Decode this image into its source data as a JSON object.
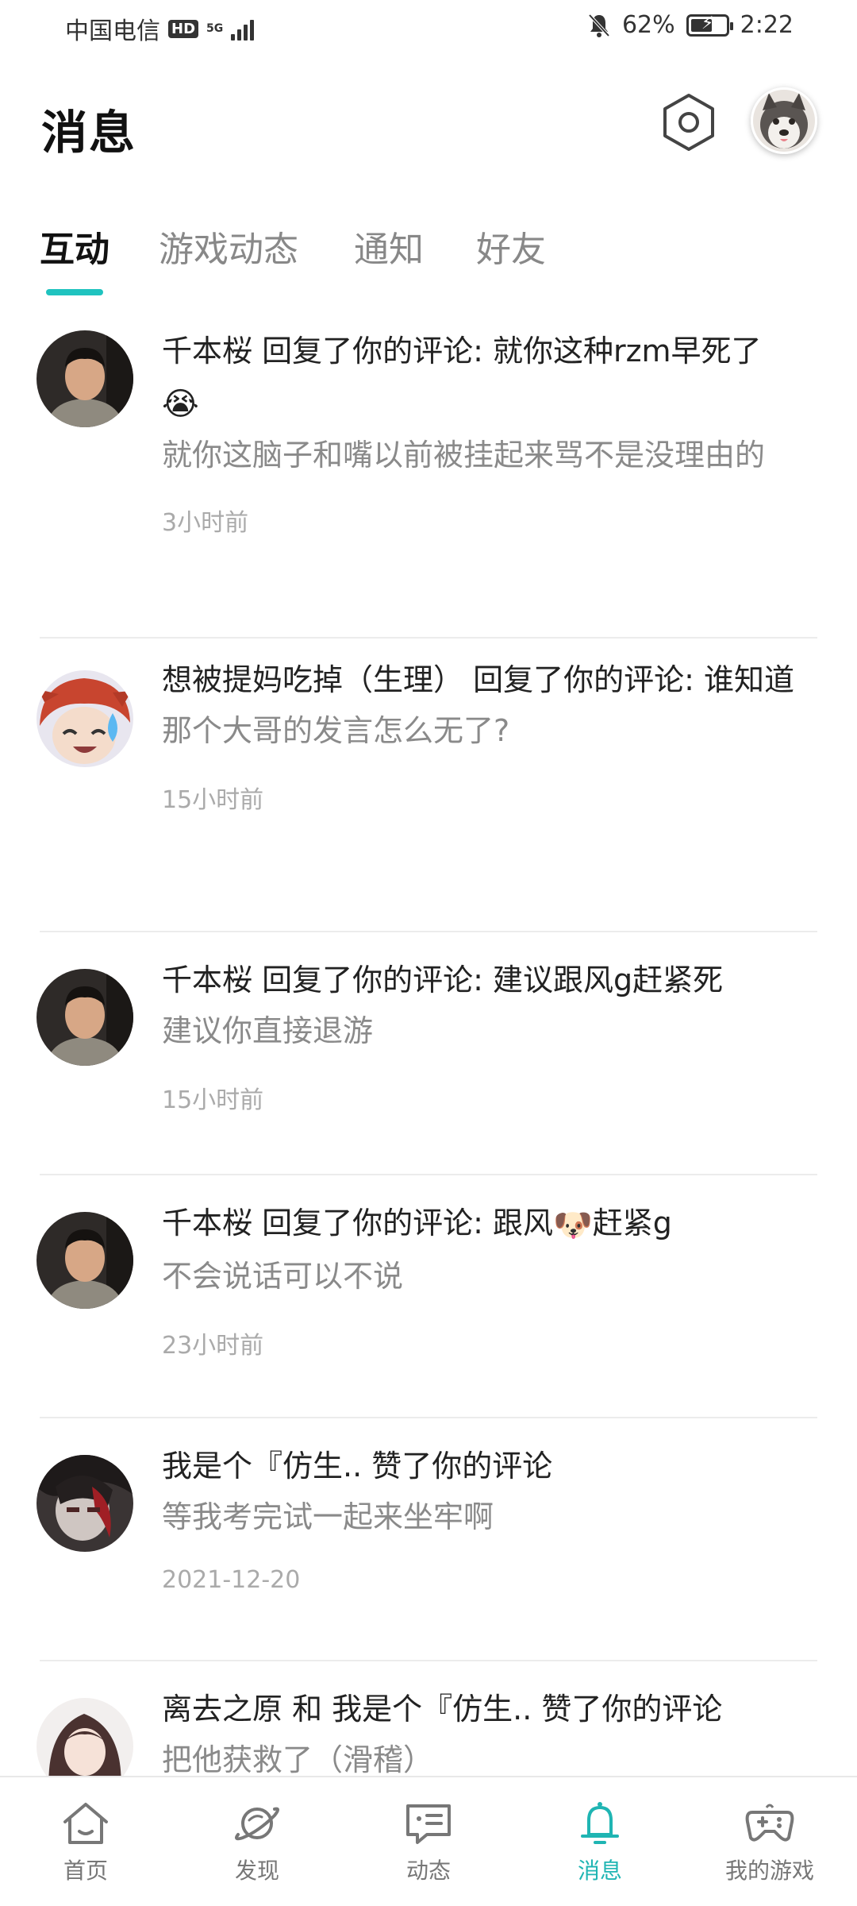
{
  "status_bar": {
    "carrier": "中国电信",
    "hd": "HD",
    "network": "5G",
    "battery_pct": "62%",
    "battery_level": 0.62,
    "time": "2:22"
  },
  "header": {
    "title": "消息"
  },
  "tabs": [
    {
      "label": "互动",
      "active": true
    },
    {
      "label": "游戏动态",
      "active": false
    },
    {
      "label": "通知",
      "active": false
    },
    {
      "label": "好友",
      "active": false
    }
  ],
  "messages": [
    {
      "line1": "千本桜 回复了你的评论: 就你这种rzm早死了",
      "line1_emoji": "😭",
      "line2": "就你这脑子和嘴以前被挂起来骂不是没理由的",
      "time": "3小时前"
    },
    {
      "line1": "想被提妈吃掉（生理） 回复了你的评论: 谁知道",
      "line2": "那个大哥的发言怎么无了?",
      "time": "15小时前"
    },
    {
      "line1": "千本桜 回复了你的评论: 建议跟风g赶紧死",
      "line2": "建议你直接退游",
      "time": "15小时前"
    },
    {
      "line1_a": "千本桜 回复了你的评论: 跟风",
      "line1_emoji": "🐶",
      "line1_b": "赶紧g",
      "line2": "不会说话可以不说",
      "time": "23小时前"
    },
    {
      "line1": "我是个『仿生.. 赞了你的评论",
      "line2": "等我考完试一起来坐牢啊",
      "time": "2021-12-20"
    },
    {
      "line1": "离去之原 和 我是个『仿生.. 赞了你的评论",
      "line2": "把他获救了（滑稽）"
    }
  ],
  "bottom_nav": [
    {
      "label": "首页",
      "icon": "home-icon",
      "active": false
    },
    {
      "label": "发现",
      "icon": "planet-icon",
      "active": false
    },
    {
      "label": "动态",
      "icon": "chat-icon",
      "active": false
    },
    {
      "label": "消息",
      "icon": "bell-icon",
      "active": true
    },
    {
      "label": "我的游戏",
      "icon": "gamepad-icon",
      "active": false
    }
  ],
  "colors": {
    "accent": "#1fc3bf",
    "text_primary": "#222222",
    "text_secondary": "#8a8a8a",
    "text_time": "#aaaaaa"
  }
}
